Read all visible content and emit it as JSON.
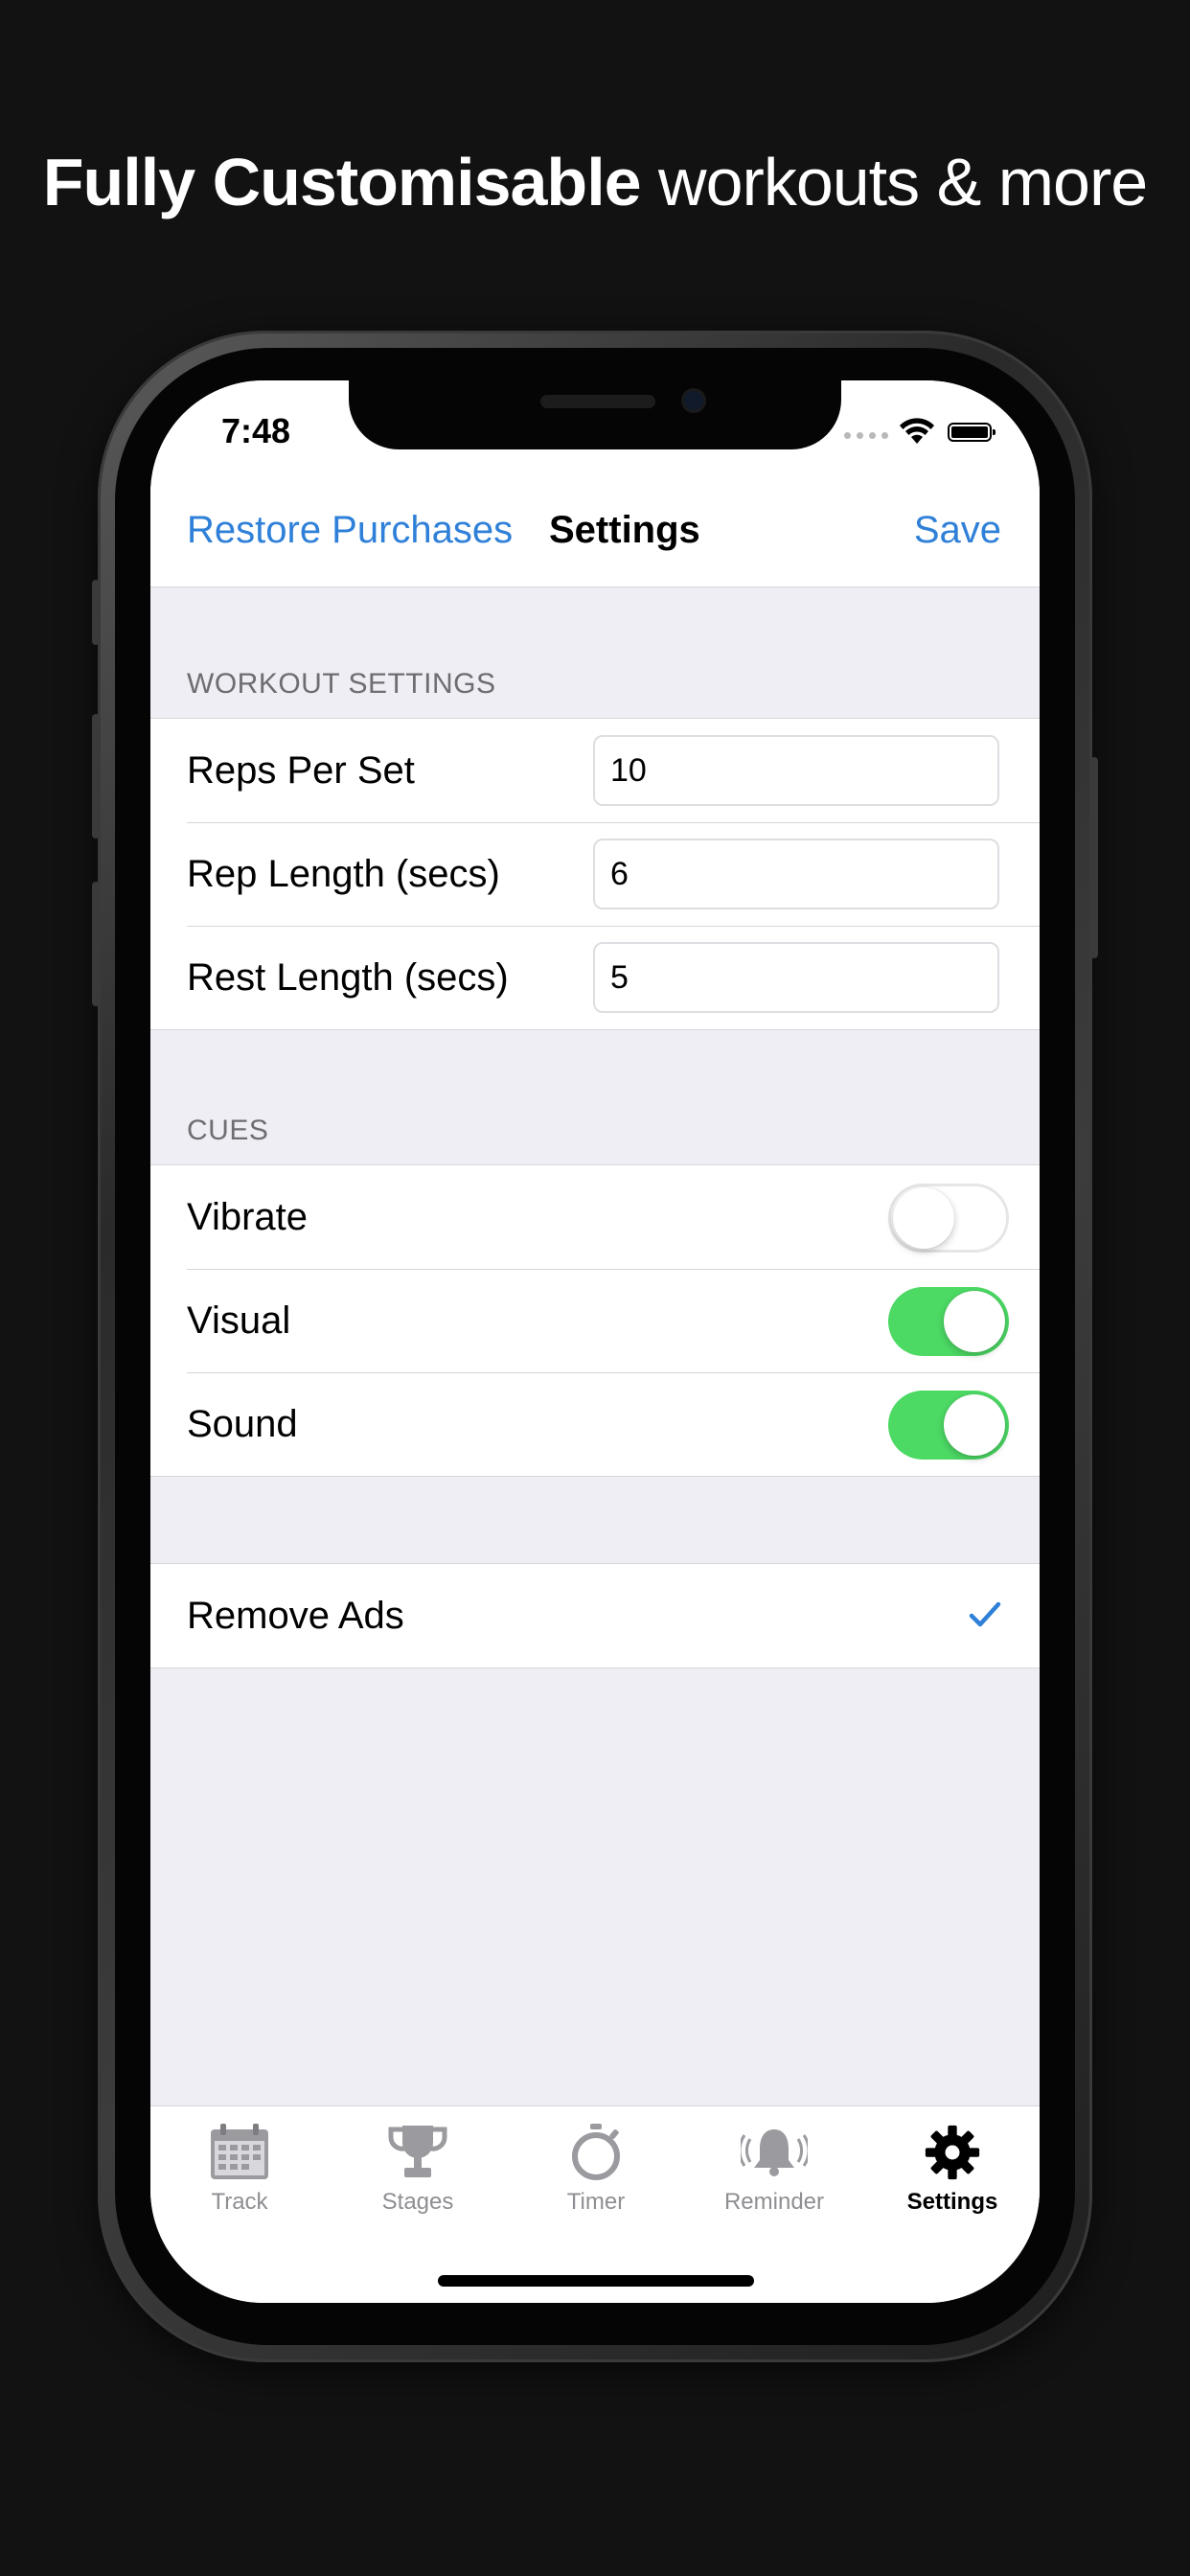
{
  "headline": {
    "bold": "Fully Customisable",
    "regular": "workouts & more"
  },
  "status_bar": {
    "time": "7:48"
  },
  "nav": {
    "left": "Restore Purchases",
    "title": "Settings",
    "right": "Save"
  },
  "workout_settings": {
    "header": "WORKOUT SETTINGS",
    "rows": [
      {
        "label": "Reps Per Set",
        "value": "10"
      },
      {
        "label": "Rep Length (secs)",
        "value": "6"
      },
      {
        "label": "Rest Length (secs)",
        "value": "5"
      }
    ]
  },
  "cues": {
    "header": "CUES",
    "rows": [
      {
        "label": "Vibrate",
        "on": false
      },
      {
        "label": "Visual",
        "on": true
      },
      {
        "label": "Sound",
        "on": true
      }
    ]
  },
  "purchases": {
    "remove_ads": "Remove Ads",
    "checked": true
  },
  "tabs": [
    {
      "label": "Track",
      "icon": "calendar-icon",
      "active": false
    },
    {
      "label": "Stages",
      "icon": "trophy-icon",
      "active": false
    },
    {
      "label": "Timer",
      "icon": "stopwatch-icon",
      "active": false
    },
    {
      "label": "Reminder",
      "icon": "bell-icon",
      "active": false
    },
    {
      "label": "Settings",
      "icon": "gear-icon",
      "active": true
    }
  ],
  "colors": {
    "accent": "#2f80d8",
    "toggle_on": "#4cd964",
    "background": "#121212",
    "group_background": "#efeef4"
  }
}
